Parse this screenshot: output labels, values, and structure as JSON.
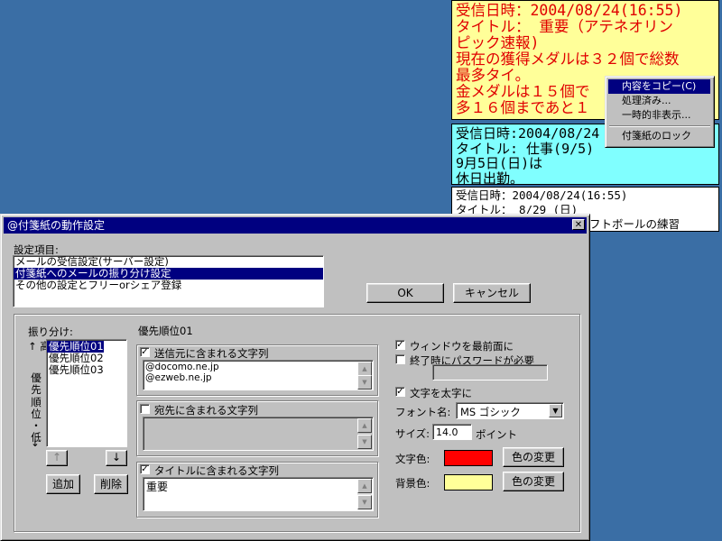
{
  "notes": [
    {
      "lines": [
        "受信日時：2004/08/24(16:55)",
        "タイトル： 重要（アテネオリン",
        "ピック速報)",
        "現在の獲得メダルは３２個で総数",
        "最多タイ。",
        "金メダルは１５個で",
        "多１６個まであと１"
      ]
    },
    {
      "lines": [
        "受信日時:2004/08/24",
        "タイトル: 仕事(9/5)",
        "9月5日(日)は",
        "休日出勤。"
      ]
    },
    {
      "lines": [
        "受信日時：2004/08/24(16:55)",
        "タイトル： 8/29 (日)",
        "フトボールの練習"
      ]
    }
  ],
  "context_menu": {
    "items": [
      "内容をコピー(C)",
      "処理済み...",
      "一時的非表示...",
      "付箋紙のロック"
    ]
  },
  "dialog": {
    "title": "@付箋紙の動作設定",
    "close_glyph": "✕",
    "settings_label": "設定項目:",
    "settings_items": [
      "メールの受信設定(サーバー設定)",
      "付箋紙へのメールの振り分け設定",
      "その他の設定とフリーorシェア登録"
    ],
    "ok_label": "OK",
    "cancel_label": "キャンセル",
    "sort_label": "振り分け:",
    "priority_high": "↑ 高",
    "priority_mid_chars": [
      "優",
      "先",
      "順",
      "位",
      "・",
      "低"
    ],
    "priority_low": "↓",
    "priority_items": [
      "優先順位01",
      "優先順位02",
      "優先順位03"
    ],
    "up_arrow": "↑",
    "down_arrow": "↓",
    "add_label": "追加",
    "delete_label": "削除",
    "priority_title": "優先順位01",
    "sender_label": "送信元に含まれる文字列",
    "sender_values": [
      "@docomo.ne.jp",
      "@ezweb.ne.jp"
    ],
    "recipient_label": "宛先に含まれる文字列",
    "recipient_value": "",
    "title_label": "タイトルに含まれる文字列",
    "title_value": "重要",
    "topmost_label": "ウィンドウを最前面に",
    "password_label": "終了時にパスワードが必要",
    "password_value": "",
    "bold_label": "文字を太字に",
    "font_label": "フォント名:",
    "font_value": "MS ゴシック",
    "size_label": "サイズ:",
    "size_value": "14.0",
    "size_unit": "ポイント",
    "text_color_label": "文字色:",
    "bg_color_label": "背景色:",
    "change_color_label": "色の変更",
    "checks": {
      "sender": true,
      "recipient": false,
      "title": true,
      "topmost": true,
      "password": false,
      "bold": true
    },
    "colors": {
      "text": "#ff0000",
      "background": "#ffff99"
    }
  }
}
